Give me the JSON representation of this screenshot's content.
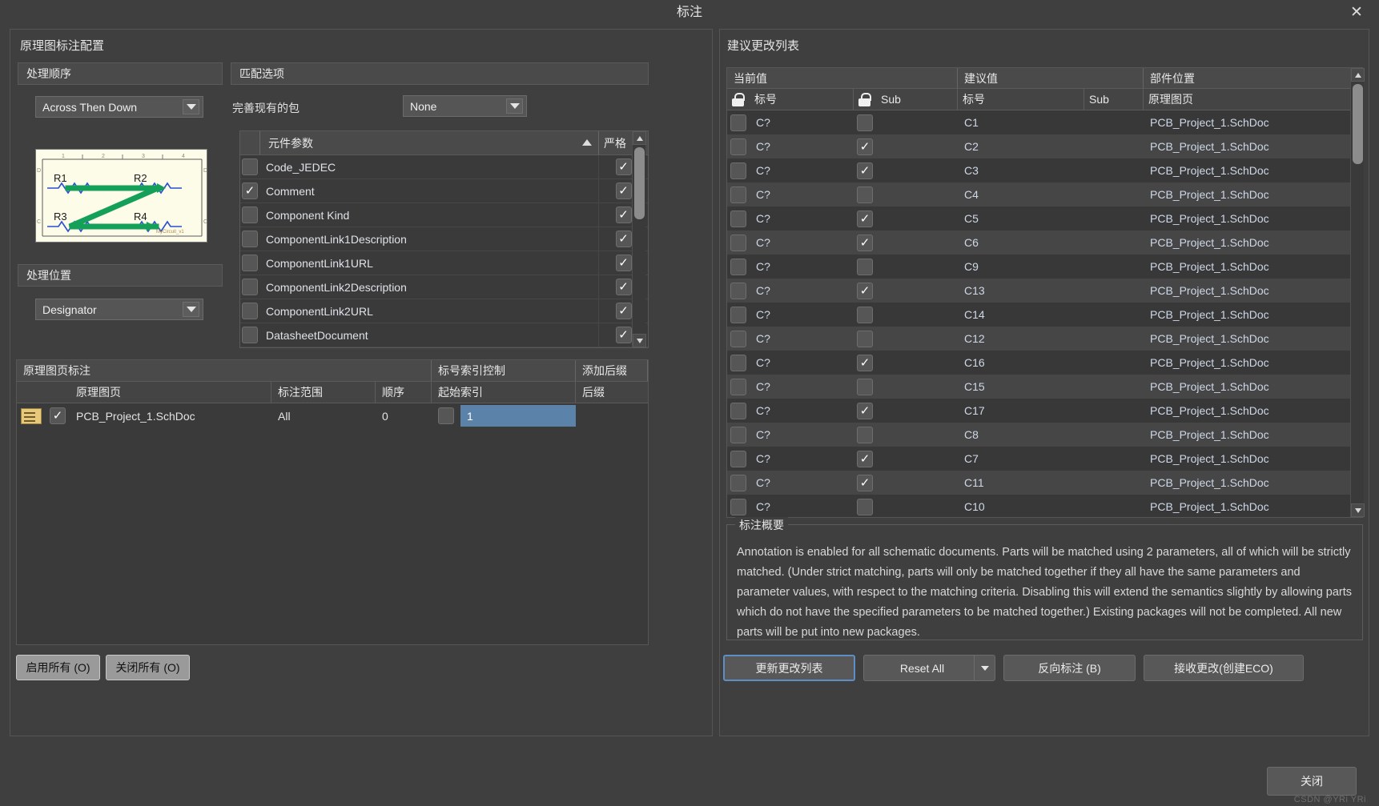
{
  "window": {
    "title": "标注",
    "close_icon": "close-icon"
  },
  "left_panel": {
    "caption": "原理图标注配置",
    "order_group": {
      "title": "处理顺序",
      "value": "Across Then Down"
    },
    "thumbnail": {
      "labels": [
        "R1",
        "R2",
        "R3",
        "R4"
      ],
      "footer": "MyCircuit_v1",
      "ruler": [
        "1",
        "2",
        "3",
        "4"
      ],
      "side_marks": [
        "D",
        "C",
        "D",
        "C"
      ]
    },
    "location_group": {
      "title": "处理位置",
      "value": "Designator"
    },
    "match_group": {
      "title": "匹配选项",
      "existing_packages_label": "完善现有的包",
      "existing_packages_value": "None",
      "columns": [
        "元件参数",
        "严格"
      ],
      "sort_indicator": "ascending",
      "rows": [
        {
          "name": "Code_JEDEC",
          "enabled": false,
          "strict": true
        },
        {
          "name": "Comment",
          "enabled": true,
          "strict": true
        },
        {
          "name": "Component Kind",
          "enabled": false,
          "strict": true
        },
        {
          "name": "ComponentLink1Description",
          "enabled": false,
          "strict": true
        },
        {
          "name": "ComponentLink1URL",
          "enabled": false,
          "strict": true
        },
        {
          "name": "ComponentLink2Description",
          "enabled": false,
          "strict": true
        },
        {
          "name": "ComponentLink2URL",
          "enabled": false,
          "strict": true
        },
        {
          "name": "DatasheetDocument",
          "enabled": false,
          "strict": true
        }
      ]
    },
    "sheet_grid": {
      "group_headers": [
        "原理图页标注",
        "标号索引控制",
        "添加后缀"
      ],
      "columns": [
        "原理图页",
        "标注范围",
        "顺序",
        "起始索引",
        "后缀"
      ],
      "rows": [
        {
          "icon": "schematic-doc-icon",
          "enabled": true,
          "doc": "PCB_Project_1.SchDoc",
          "scope": "All",
          "order": "0",
          "start_index_checked": false,
          "start_index": "1",
          "suffix": ""
        }
      ]
    },
    "buttons": {
      "enable_all": "启用所有 (O)",
      "disable_all": "关闭所有 (O)"
    }
  },
  "right_panel": {
    "caption": "建议更改列表",
    "grid": {
      "group_headers": [
        "当前值",
        "建议值",
        "部件位置"
      ],
      "columns": [
        "标号",
        "Sub",
        "标号",
        "Sub",
        "原理图页"
      ],
      "lock_icon": "lock-icon",
      "rows": [
        {
          "cur_lock": false,
          "cur_desig": "C?",
          "cur_sub_lock": false,
          "cur_sub": "",
          "new_desig": "C1",
          "new_sub": "",
          "sheet": "PCB_Project_1.SchDoc"
        },
        {
          "cur_lock": false,
          "cur_desig": "C?",
          "cur_sub_lock": true,
          "cur_sub": "",
          "new_desig": "C2",
          "new_sub": "",
          "sheet": "PCB_Project_1.SchDoc"
        },
        {
          "cur_lock": false,
          "cur_desig": "C?",
          "cur_sub_lock": true,
          "cur_sub": "",
          "new_desig": "C3",
          "new_sub": "",
          "sheet": "PCB_Project_1.SchDoc"
        },
        {
          "cur_lock": false,
          "cur_desig": "C?",
          "cur_sub_lock": false,
          "cur_sub": "",
          "new_desig": "C4",
          "new_sub": "",
          "sheet": "PCB_Project_1.SchDoc"
        },
        {
          "cur_lock": false,
          "cur_desig": "C?",
          "cur_sub_lock": true,
          "cur_sub": "",
          "new_desig": "C5",
          "new_sub": "",
          "sheet": "PCB_Project_1.SchDoc"
        },
        {
          "cur_lock": false,
          "cur_desig": "C?",
          "cur_sub_lock": true,
          "cur_sub": "",
          "new_desig": "C6",
          "new_sub": "",
          "sheet": "PCB_Project_1.SchDoc"
        },
        {
          "cur_lock": false,
          "cur_desig": "C?",
          "cur_sub_lock": false,
          "cur_sub": "",
          "new_desig": "C9",
          "new_sub": "",
          "sheet": "PCB_Project_1.SchDoc"
        },
        {
          "cur_lock": false,
          "cur_desig": "C?",
          "cur_sub_lock": true,
          "cur_sub": "",
          "new_desig": "C13",
          "new_sub": "",
          "sheet": "PCB_Project_1.SchDoc"
        },
        {
          "cur_lock": false,
          "cur_desig": "C?",
          "cur_sub_lock": false,
          "cur_sub": "",
          "new_desig": "C14",
          "new_sub": "",
          "sheet": "PCB_Project_1.SchDoc"
        },
        {
          "cur_lock": false,
          "cur_desig": "C?",
          "cur_sub_lock": false,
          "cur_sub": "",
          "new_desig": "C12",
          "new_sub": "",
          "sheet": "PCB_Project_1.SchDoc"
        },
        {
          "cur_lock": false,
          "cur_desig": "C?",
          "cur_sub_lock": true,
          "cur_sub": "",
          "new_desig": "C16",
          "new_sub": "",
          "sheet": "PCB_Project_1.SchDoc"
        },
        {
          "cur_lock": false,
          "cur_desig": "C?",
          "cur_sub_lock": false,
          "cur_sub": "",
          "new_desig": "C15",
          "new_sub": "",
          "sheet": "PCB_Project_1.SchDoc"
        },
        {
          "cur_lock": false,
          "cur_desig": "C?",
          "cur_sub_lock": true,
          "cur_sub": "",
          "new_desig": "C17",
          "new_sub": "",
          "sheet": "PCB_Project_1.SchDoc"
        },
        {
          "cur_lock": false,
          "cur_desig": "C?",
          "cur_sub_lock": false,
          "cur_sub": "",
          "new_desig": "C8",
          "new_sub": "",
          "sheet": "PCB_Project_1.SchDoc"
        },
        {
          "cur_lock": false,
          "cur_desig": "C?",
          "cur_sub_lock": true,
          "cur_sub": "",
          "new_desig": "C7",
          "new_sub": "",
          "sheet": "PCB_Project_1.SchDoc"
        },
        {
          "cur_lock": false,
          "cur_desig": "C?",
          "cur_sub_lock": true,
          "cur_sub": "",
          "new_desig": "C11",
          "new_sub": "",
          "sheet": "PCB_Project_1.SchDoc"
        },
        {
          "cur_lock": false,
          "cur_desig": "C?",
          "cur_sub_lock": false,
          "cur_sub": "",
          "new_desig": "C10",
          "new_sub": "",
          "sheet": "PCB_Project_1.SchDoc"
        }
      ]
    },
    "summary": {
      "title": "标注概要",
      "text": "Annotation is enabled for all schematic documents. Parts will be matched using 2 parameters, all of which will be strictly matched. (Under strict matching, parts will only be matched together if they all have the same parameters and parameter values, with respect to the matching criteria. Disabling this will extend the semantics slightly by allowing parts which do not have the specified parameters to be matched together.) Existing packages will not be completed. All new parts will be put into new packages."
    },
    "buttons": {
      "update_list": "更新更改列表",
      "reset_all": "Reset All",
      "back_annotate": "反向标注 (B)",
      "accept_changes": "接收更改(创建ECO)"
    }
  },
  "footer": {
    "close": "关闭",
    "watermark": "CSDN @YRi YRi"
  },
  "colors": {
    "dialog_bg": "#3f3f3f",
    "grid_bg": "#383838",
    "header_bg": "#4a4a4a",
    "selection_blue": "#5b82a8",
    "accent_border": "#5d8fc4",
    "text": "#e0e0e0",
    "value_text": "#cfd8e8",
    "schematic_paper": "#fdfce8",
    "wire_green": "#15a05a"
  }
}
